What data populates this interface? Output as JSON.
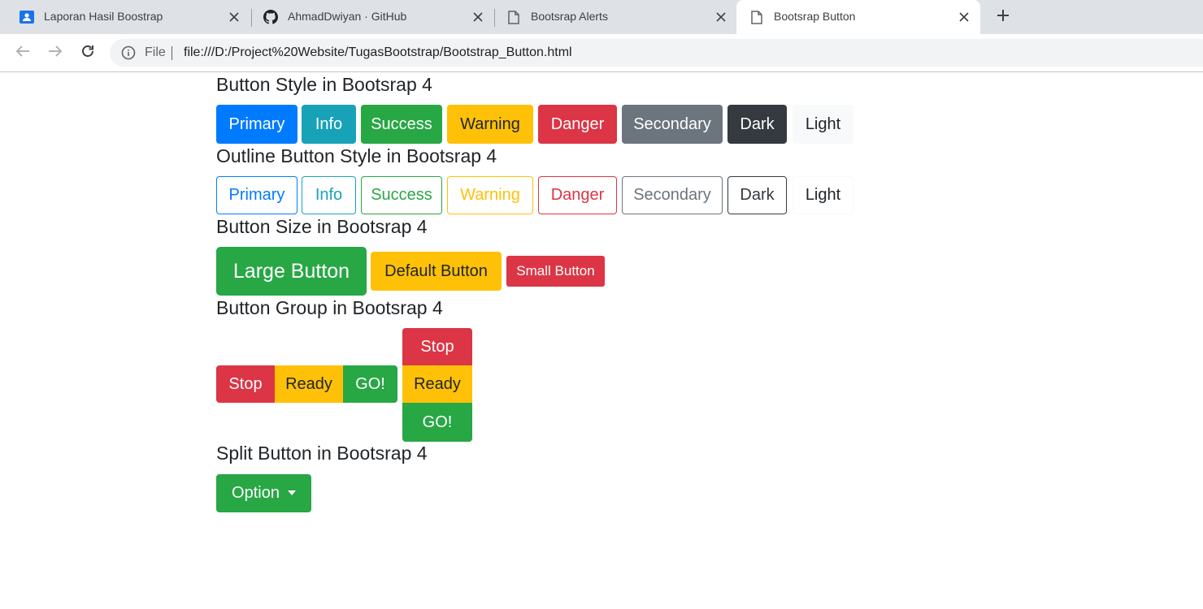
{
  "browser": {
    "tabs": [
      {
        "title": "Laporan Hasil Boostrap",
        "icon": "contact-card-icon"
      },
      {
        "title": "AhmadDwiyan · GitHub",
        "icon": "github-icon"
      },
      {
        "title": "Bootsrap Alerts",
        "icon": "document-icon"
      },
      {
        "title": "Bootsrap Button",
        "icon": "document-icon"
      }
    ],
    "active_tab": 3,
    "address": {
      "scheme_label": "File",
      "url": "file:///D:/Project%20Website/TugasBootstrap/Bootstrap_Button.html"
    }
  },
  "sections": {
    "style": {
      "heading": "Button Style in Bootsrap 4",
      "buttons": [
        "Primary",
        "Info",
        "Success",
        "Warning",
        "Danger",
        "Secondary",
        "Dark",
        "Light"
      ]
    },
    "outline": {
      "heading": "Outline Button Style in Bootsrap 4",
      "buttons": [
        "Primary",
        "Info",
        "Success",
        "Warning",
        "Danger",
        "Secondary",
        "Dark",
        "Light"
      ]
    },
    "size": {
      "heading": "Button Size in Bootsrap 4",
      "buttons": [
        "Large Button",
        "Default Button",
        "Small Button"
      ]
    },
    "group": {
      "heading": "Button Group in Bootsrap 4",
      "horizontal": [
        "Stop",
        "Ready",
        "GO!"
      ],
      "vertical": [
        "Stop",
        "Ready",
        "GO!"
      ]
    },
    "split": {
      "heading": "Split Button in Bootsrap 4",
      "button": "Option"
    }
  },
  "colors": {
    "primary": "#007bff",
    "info": "#17a2b8",
    "success": "#28a745",
    "warning": "#ffc107",
    "danger": "#dc3545",
    "secondary": "#6c757d",
    "dark": "#343a40",
    "light": "#f8f9fa"
  }
}
